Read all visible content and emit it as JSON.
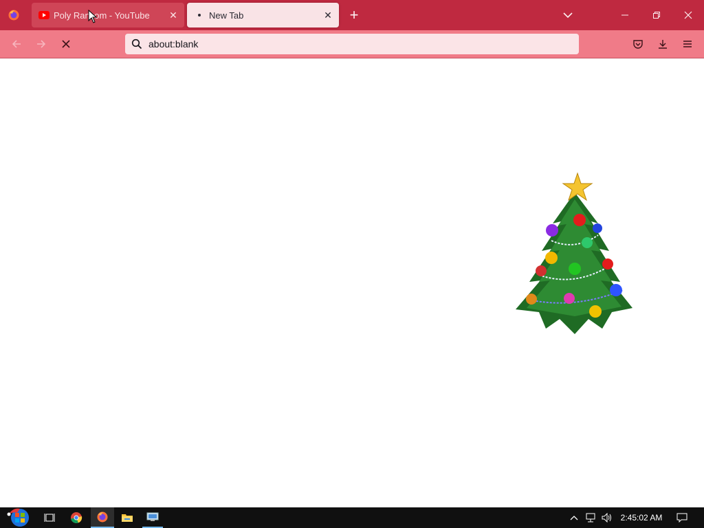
{
  "browser": {
    "tabs": [
      {
        "title": "Poly Ransom - YouTube",
        "icon": "youtube-icon",
        "active": false
      },
      {
        "title": "New Tab",
        "icon": "dot-icon",
        "active": true
      }
    ],
    "url": "about:blank",
    "theme_colors": {
      "tabstrip": "#bf2940",
      "navbar": "#f07b88",
      "urlbar": "#fbe4e7"
    }
  },
  "content": {
    "image": "christmas-tree"
  },
  "taskbar": {
    "apps": [
      "start-button",
      "task-view",
      "chrome",
      "firefox",
      "file-explorer",
      "remote-desktop"
    ],
    "clock": "2:45:02 AM"
  }
}
